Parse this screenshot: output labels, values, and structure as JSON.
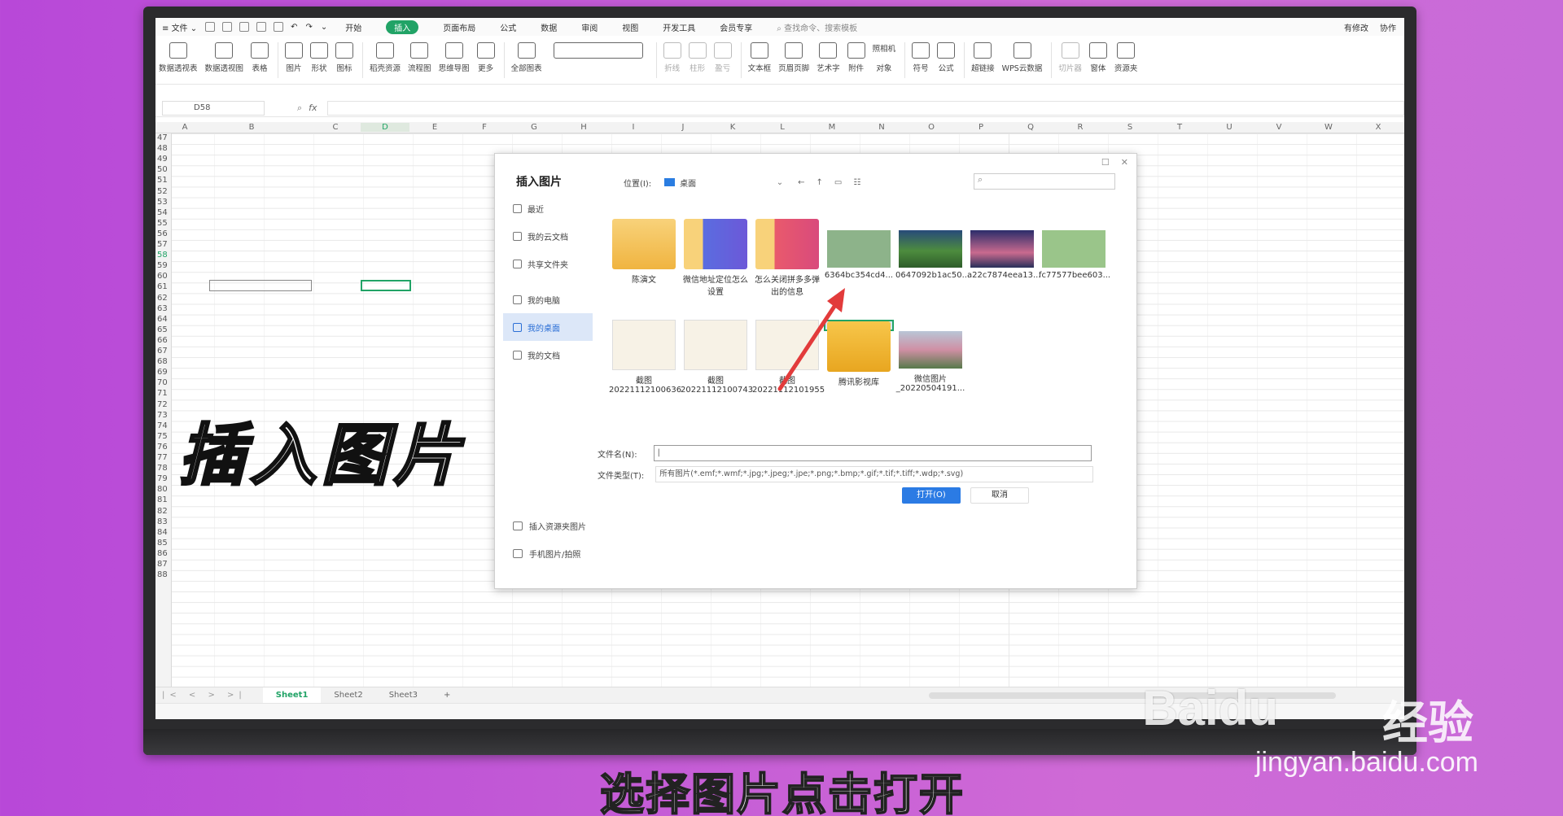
{
  "menubar": {
    "file": "文件",
    "tabs": [
      "开始",
      "插入",
      "页面布局",
      "公式",
      "数据",
      "审阅",
      "视图",
      "开发工具",
      "会员专享"
    ],
    "active_tab": "插入",
    "search": "查找命令、搜索模板",
    "right": [
      "有修改",
      "协作"
    ]
  },
  "ribbon": {
    "groups": [
      [
        "数据透视表",
        "数据透视图",
        "表格"
      ],
      [
        "图片",
        "形状",
        "图标"
      ],
      [
        "稻壳资源",
        "流程图",
        "思维导图",
        "更多"
      ],
      [
        "全部图表"
      ],
      [
        "折线",
        "柱形",
        "盈亏"
      ],
      [
        "文本框",
        "页眉页脚",
        "艺术字",
        "附件",
        "对象"
      ],
      [
        "符号",
        "公式"
      ],
      [
        "超链接",
        "WPS云数据"
      ],
      [
        "切片器",
        "窗体",
        "资源夹"
      ]
    ],
    "extra": "照相机",
    "greyed": [
      "折线",
      "柱形",
      "盈亏",
      "切片器"
    ]
  },
  "formula_bar": {
    "name_box": "D58",
    "fx": "fx"
  },
  "columns": [
    "A",
    "B",
    "C",
    "D",
    "E",
    "F",
    "G",
    "H",
    "I",
    "J",
    "K",
    "L",
    "M",
    "N",
    "O",
    "P",
    "Q",
    "R",
    "S",
    "T",
    "U",
    "V",
    "W",
    "X"
  ],
  "rows": [
    "47",
    "48",
    "49",
    "50",
    "51",
    "52",
    "53",
    "54",
    "55",
    "56",
    "57",
    "58",
    "59",
    "60",
    "61",
    "62",
    "63",
    "64",
    "65",
    "66",
    "67",
    "68",
    "69",
    "70",
    "71",
    "72",
    "73",
    "74",
    "75",
    "76",
    "77",
    "78",
    "79",
    "80",
    "81",
    "82",
    "83",
    "84",
    "85",
    "86",
    "87",
    "88"
  ],
  "sheets": [
    "Sheet1",
    "Sheet2",
    "Sheet3"
  ],
  "active_sheet": "Sheet1",
  "overlay_caption": "插入图片",
  "dialog": {
    "title": "插入图片",
    "location_label": "位置(I):",
    "location_value": "桌面",
    "sidebar": [
      "最近",
      "我的云文档",
      "共享文件夹",
      "我的电脑",
      "我的桌面",
      "我的文档"
    ],
    "sidebar_active": "我的桌面",
    "sidebar_bottom": [
      "插入资源夹图片",
      "手机图片/拍照"
    ],
    "files": [
      {
        "label": "陈演文",
        "kind": "folder"
      },
      {
        "label": "微信地址定位怎么设置",
        "kind": "book"
      },
      {
        "label": "怎么关闭拼多多弹出的信息",
        "kind": "book2"
      },
      {
        "label": "6364bc354cd4...",
        "kind": "img1"
      },
      {
        "label": "0647092b1ac50...",
        "kind": "img2"
      },
      {
        "label": "a22c7874eea13...",
        "kind": "img3"
      },
      {
        "label": "fc77577bee603...",
        "kind": "img4"
      },
      {
        "label": "截图 20221112100636",
        "kind": "shot"
      },
      {
        "label": "截图 20221112100743",
        "kind": "shot"
      },
      {
        "label": "截图 20221112101955",
        "kind": "shot"
      },
      {
        "label": "腾讯影视库",
        "kind": "tencent"
      },
      {
        "label": "微信图片 _20220504191...",
        "kind": "img5"
      }
    ],
    "filename_label": "文件名(N):",
    "filetype_label": "文件类型(T):",
    "filetype_value": "所有图片(*.emf;*.wmf;*.jpg;*.jpeg;*.jpe;*.png;*.bmp;*.gif;*.tif;*.tiff;*.wdp;*.svg)",
    "open_button": "打开(O)",
    "cancel_button": "取消"
  },
  "bottom_caption": "选择图片点击打开",
  "watermark": {
    "brand": "Baidu",
    "cn": "经验",
    "url": "jingyan.baidu.com"
  },
  "colors": {
    "accent": "#21a366",
    "dialog_primary": "#2b7be4",
    "arrow": "#e23b3b"
  }
}
